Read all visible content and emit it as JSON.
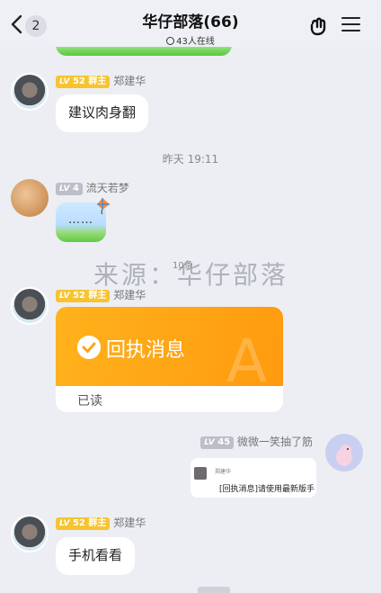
{
  "header": {
    "unread_count": "2",
    "title": "华仔部落(66)",
    "online": "43人在线",
    "icons": [
      "chevron-left-icon",
      "hand-sign-icon",
      "menu-icon"
    ]
  },
  "messages": [
    {
      "level": "52",
      "role": "群主",
      "name": "郑建华",
      "text": "建议肉身翻"
    },
    {
      "time": "昨天 19:11"
    },
    {
      "level": "4",
      "name": "流天若梦",
      "text": "……"
    },
    {
      "level": "52",
      "role": "群主",
      "name": "郑建华",
      "receipt_title": "回执消息",
      "receipt_status": "已读",
      "receipt_watermark": "A"
    },
    {
      "level": "45",
      "name": "微微一笑抽了筋",
      "quote_name": "郑建华",
      "quote_text": "[回执消息]请使用最新版手"
    },
    {
      "level": "52",
      "role": "群主",
      "name": "郑建华",
      "text": "手机看看"
    }
  ],
  "watermark": {
    "text": "来源：华仔部落",
    "small": "10条"
  },
  "level_prefix": "LV",
  "colors": {
    "receipt": "#ff9a0f",
    "owner_badge": "#f7c430",
    "level_badge": "#bcbfc7",
    "background": "#eceef3"
  }
}
